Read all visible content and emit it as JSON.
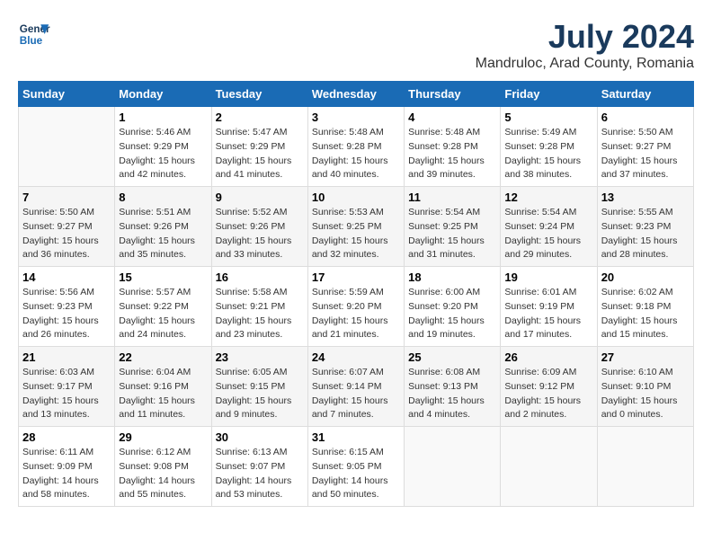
{
  "header": {
    "logo_line1": "General",
    "logo_line2": "Blue",
    "title": "July 2024",
    "subtitle": "Mandruloc, Arad County, Romania"
  },
  "weekdays": [
    "Sunday",
    "Monday",
    "Tuesday",
    "Wednesday",
    "Thursday",
    "Friday",
    "Saturday"
  ],
  "weeks": [
    {
      "days": [
        {
          "num": "",
          "info": ""
        },
        {
          "num": "1",
          "info": "Sunrise: 5:46 AM\nSunset: 9:29 PM\nDaylight: 15 hours\nand 42 minutes."
        },
        {
          "num": "2",
          "info": "Sunrise: 5:47 AM\nSunset: 9:29 PM\nDaylight: 15 hours\nand 41 minutes."
        },
        {
          "num": "3",
          "info": "Sunrise: 5:48 AM\nSunset: 9:28 PM\nDaylight: 15 hours\nand 40 minutes."
        },
        {
          "num": "4",
          "info": "Sunrise: 5:48 AM\nSunset: 9:28 PM\nDaylight: 15 hours\nand 39 minutes."
        },
        {
          "num": "5",
          "info": "Sunrise: 5:49 AM\nSunset: 9:28 PM\nDaylight: 15 hours\nand 38 minutes."
        },
        {
          "num": "6",
          "info": "Sunrise: 5:50 AM\nSunset: 9:27 PM\nDaylight: 15 hours\nand 37 minutes."
        }
      ],
      "alt": false
    },
    {
      "days": [
        {
          "num": "7",
          "info": "Sunrise: 5:50 AM\nSunset: 9:27 PM\nDaylight: 15 hours\nand 36 minutes."
        },
        {
          "num": "8",
          "info": "Sunrise: 5:51 AM\nSunset: 9:26 PM\nDaylight: 15 hours\nand 35 minutes."
        },
        {
          "num": "9",
          "info": "Sunrise: 5:52 AM\nSunset: 9:26 PM\nDaylight: 15 hours\nand 33 minutes."
        },
        {
          "num": "10",
          "info": "Sunrise: 5:53 AM\nSunset: 9:25 PM\nDaylight: 15 hours\nand 32 minutes."
        },
        {
          "num": "11",
          "info": "Sunrise: 5:54 AM\nSunset: 9:25 PM\nDaylight: 15 hours\nand 31 minutes."
        },
        {
          "num": "12",
          "info": "Sunrise: 5:54 AM\nSunset: 9:24 PM\nDaylight: 15 hours\nand 29 minutes."
        },
        {
          "num": "13",
          "info": "Sunrise: 5:55 AM\nSunset: 9:23 PM\nDaylight: 15 hours\nand 28 minutes."
        }
      ],
      "alt": true
    },
    {
      "days": [
        {
          "num": "14",
          "info": "Sunrise: 5:56 AM\nSunset: 9:23 PM\nDaylight: 15 hours\nand 26 minutes."
        },
        {
          "num": "15",
          "info": "Sunrise: 5:57 AM\nSunset: 9:22 PM\nDaylight: 15 hours\nand 24 minutes."
        },
        {
          "num": "16",
          "info": "Sunrise: 5:58 AM\nSunset: 9:21 PM\nDaylight: 15 hours\nand 23 minutes."
        },
        {
          "num": "17",
          "info": "Sunrise: 5:59 AM\nSunset: 9:20 PM\nDaylight: 15 hours\nand 21 minutes."
        },
        {
          "num": "18",
          "info": "Sunrise: 6:00 AM\nSunset: 9:20 PM\nDaylight: 15 hours\nand 19 minutes."
        },
        {
          "num": "19",
          "info": "Sunrise: 6:01 AM\nSunset: 9:19 PM\nDaylight: 15 hours\nand 17 minutes."
        },
        {
          "num": "20",
          "info": "Sunrise: 6:02 AM\nSunset: 9:18 PM\nDaylight: 15 hours\nand 15 minutes."
        }
      ],
      "alt": false
    },
    {
      "days": [
        {
          "num": "21",
          "info": "Sunrise: 6:03 AM\nSunset: 9:17 PM\nDaylight: 15 hours\nand 13 minutes."
        },
        {
          "num": "22",
          "info": "Sunrise: 6:04 AM\nSunset: 9:16 PM\nDaylight: 15 hours\nand 11 minutes."
        },
        {
          "num": "23",
          "info": "Sunrise: 6:05 AM\nSunset: 9:15 PM\nDaylight: 15 hours\nand 9 minutes."
        },
        {
          "num": "24",
          "info": "Sunrise: 6:07 AM\nSunset: 9:14 PM\nDaylight: 15 hours\nand 7 minutes."
        },
        {
          "num": "25",
          "info": "Sunrise: 6:08 AM\nSunset: 9:13 PM\nDaylight: 15 hours\nand 4 minutes."
        },
        {
          "num": "26",
          "info": "Sunrise: 6:09 AM\nSunset: 9:12 PM\nDaylight: 15 hours\nand 2 minutes."
        },
        {
          "num": "27",
          "info": "Sunrise: 6:10 AM\nSunset: 9:10 PM\nDaylight: 15 hours\nand 0 minutes."
        }
      ],
      "alt": true
    },
    {
      "days": [
        {
          "num": "28",
          "info": "Sunrise: 6:11 AM\nSunset: 9:09 PM\nDaylight: 14 hours\nand 58 minutes."
        },
        {
          "num": "29",
          "info": "Sunrise: 6:12 AM\nSunset: 9:08 PM\nDaylight: 14 hours\nand 55 minutes."
        },
        {
          "num": "30",
          "info": "Sunrise: 6:13 AM\nSunset: 9:07 PM\nDaylight: 14 hours\nand 53 minutes."
        },
        {
          "num": "31",
          "info": "Sunrise: 6:15 AM\nSunset: 9:05 PM\nDaylight: 14 hours\nand 50 minutes."
        },
        {
          "num": "",
          "info": ""
        },
        {
          "num": "",
          "info": ""
        },
        {
          "num": "",
          "info": ""
        }
      ],
      "alt": false
    }
  ]
}
